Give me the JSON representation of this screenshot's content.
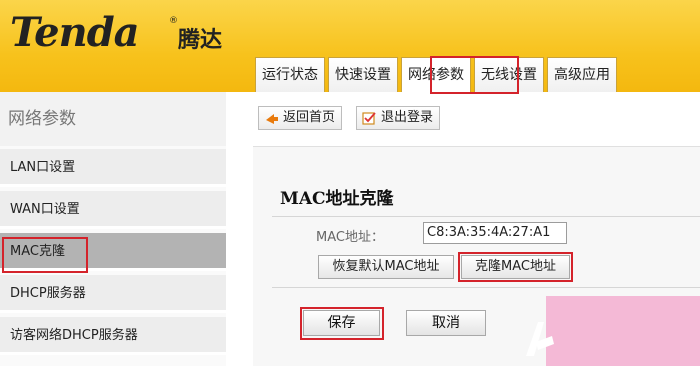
{
  "brand": {
    "logo_text": "Tenda",
    "logo_cn": "腾达",
    "reg_mark": "®"
  },
  "tabs": [
    {
      "label": "运行状态"
    },
    {
      "label": "快速设置"
    },
    {
      "label": "网络参数"
    },
    {
      "label": "无线设置"
    },
    {
      "label": "高级应用"
    }
  ],
  "active_tab": "网络参数",
  "sidebar": {
    "title": "网络参数",
    "items": [
      {
        "label": "LAN口设置"
      },
      {
        "label": "WAN口设置"
      },
      {
        "label": "MAC克隆"
      },
      {
        "label": "DHCP服务器"
      },
      {
        "label": "访客网络DHCP服务器"
      }
    ],
    "active_item": "MAC克隆"
  },
  "toolbar": {
    "home_label": "返回首页",
    "logout_label": "退出登录"
  },
  "mac_clone": {
    "title": "MAC地址克隆",
    "mac_label": "MAC地址：",
    "mac_value": "C8:3A:35:4A:27:A1",
    "restore_label": "恢复默认MAC地址",
    "clone_label": "克隆MAC地址"
  },
  "actions": {
    "save_label": "保存",
    "cancel_label": "取消"
  },
  "colors": {
    "header": "#f7c21c",
    "highlight": "#d4232b",
    "active_sidebar": "#b3b3b3",
    "watermark": "#f4b9d6"
  },
  "icons": [
    "home-arrow-icon",
    "logout-check-icon",
    "watermark-logo-icon"
  ]
}
